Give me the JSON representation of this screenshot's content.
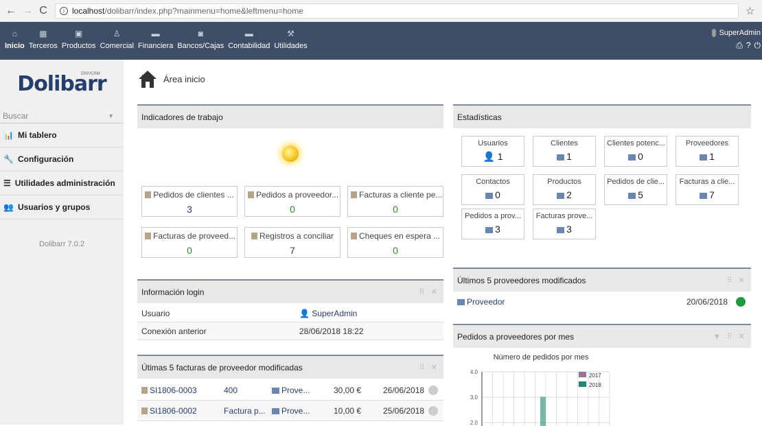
{
  "browser": {
    "host": "localhost",
    "path": "/dolibarr/index.php?mainmenu=home&leftmenu=home"
  },
  "menu": [
    {
      "label": "Inicio",
      "icon": "home-icon"
    },
    {
      "label": "Terceros",
      "icon": "building-icon"
    },
    {
      "label": "Productos",
      "icon": "cube-icon"
    },
    {
      "label": "Comercial",
      "icon": "person-icon"
    },
    {
      "label": "Financiera",
      "icon": "folder-icon"
    },
    {
      "label": "Bancos/Cajas",
      "icon": "bank-icon"
    },
    {
      "label": "Contabilidad",
      "icon": "ledger-icon"
    },
    {
      "label": "Utilidades",
      "icon": "tools-icon"
    }
  ],
  "user": {
    "name": "SuperAdmin"
  },
  "logo": {
    "text": "Dolibarr",
    "sub": "ERP/CRM"
  },
  "left": {
    "search_placeholder": "Buscar",
    "items": [
      {
        "label": "Mi tablero",
        "icon": "chart-icon"
      },
      {
        "label": "Configuración",
        "icon": "wrench-icon"
      },
      {
        "label": "Utilidades administración",
        "icon": "list-icon"
      },
      {
        "label": "Usuarios y grupos",
        "icon": "users-icon"
      }
    ],
    "version": "Dolibarr 7.0.2"
  },
  "page": {
    "title": "Área inicio"
  },
  "work": {
    "title": "Indicadores de trabajo",
    "cards": [
      {
        "label": "Pedidos de clientes ...",
        "value": "3"
      },
      {
        "label": "Pedidos a proveedor...",
        "value": "0"
      },
      {
        "label": "Facturas a cliente pe...",
        "value": "0"
      },
      {
        "label": "Facturas de proveed...",
        "value": "0"
      },
      {
        "label": "Registros a conciliar",
        "value": "7"
      },
      {
        "label": "Cheques en espera ...",
        "value": "0"
      }
    ]
  },
  "login": {
    "title": "Información login",
    "user_label": "Usuario",
    "user_value": "SuperAdmin",
    "prev_label": "Conexión anterior",
    "prev_value": "28/06/2018 18:22"
  },
  "invoices": {
    "title": "Útimas 5 facturas de proveedor modificadas",
    "rows": [
      {
        "ref": "SI1806-0003",
        "label": "400",
        "supplier": "Prove...",
        "amount": "30,00 €",
        "date": "26/06/2018"
      },
      {
        "ref": "SI1806-0002",
        "label": "Factura p...",
        "supplier": "Prove...",
        "amount": "10,00 €",
        "date": "25/06/2018"
      }
    ]
  },
  "stats": {
    "title": "Estadísticas",
    "cards": [
      {
        "label": "Usuarios",
        "value": "1"
      },
      {
        "label": "Clientes",
        "value": "1"
      },
      {
        "label": "Clientes potenc...",
        "value": "0"
      },
      {
        "label": "Proveedores",
        "value": "1"
      },
      {
        "label": "Contactos",
        "value": "0"
      },
      {
        "label": "Productos",
        "value": "2"
      },
      {
        "label": "Pedidos de clie...",
        "value": "5"
      },
      {
        "label": "Facturas a clie...",
        "value": "7"
      },
      {
        "label": "Pedidos a prov...",
        "value": "3"
      },
      {
        "label": "Facturas prove...",
        "value": "3"
      }
    ]
  },
  "suppliers": {
    "title": "Últimos 5 proveedores modificados",
    "rows": [
      {
        "name": "Proveedor",
        "date": "20/06/2018"
      }
    ]
  },
  "orders": {
    "title": "Pedidos a proveedores por mes"
  },
  "colors": {
    "s2017": "#957596",
    "s2018": "#1f8a70"
  },
  "chart_data": {
    "type": "bar",
    "title": "Número de pedidos por mes",
    "yticks": [
      "4.0",
      "3.0",
      "2.0"
    ],
    "ylim": [
      2,
      4
    ],
    "series": [
      {
        "name": "2017",
        "values": [
          0
        ]
      },
      {
        "name": "2018",
        "values": [
          3
        ]
      }
    ]
  }
}
